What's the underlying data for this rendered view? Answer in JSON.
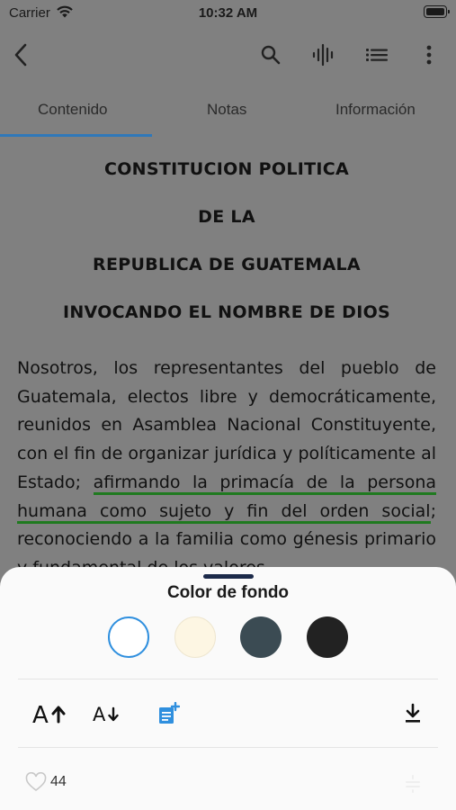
{
  "status": {
    "carrier": "Carrier",
    "time": "10:32 AM"
  },
  "toolbar": {
    "back": "back-arrow-icon",
    "search": "search-icon",
    "audio": "audio-wave-icon",
    "list": "list-icon",
    "more": "more-vertical-icon"
  },
  "tabs": [
    {
      "label": "Contenido",
      "active": true
    },
    {
      "label": "Notas",
      "active": false
    },
    {
      "label": "Información",
      "active": false
    }
  ],
  "document": {
    "headings": [
      "CONSTITUCION POLITICA",
      "DE LA",
      "REPUBLICA DE GUATEMALA",
      "INVOCANDO EL NOMBRE DE DIOS"
    ],
    "paragraph_before": "Nosotros, los representantes del pueblo de Guatemala, electos libre y democráticamente, reunidos en Asamblea Nacional Constituyente, con el fin de organizar jurídica y políticamente al Estado; ",
    "highlight": "afirmando la primacía de la persona humana como sujeto y fin del orden social",
    "paragraph_after": "; reconociendo a la familia como génesis primario y fundamental de los valores"
  },
  "sheet": {
    "title": "Color de fondo",
    "swatches": [
      {
        "name": "white",
        "color": "#ffffff",
        "selected": true
      },
      {
        "name": "cream",
        "color": "#fdf6e3",
        "selected": false
      },
      {
        "name": "slate",
        "color": "#3b4b53",
        "selected": false
      },
      {
        "name": "black",
        "color": "#222222",
        "selected": false
      }
    ],
    "accent_color": "#2f8fde",
    "likes": "44"
  }
}
